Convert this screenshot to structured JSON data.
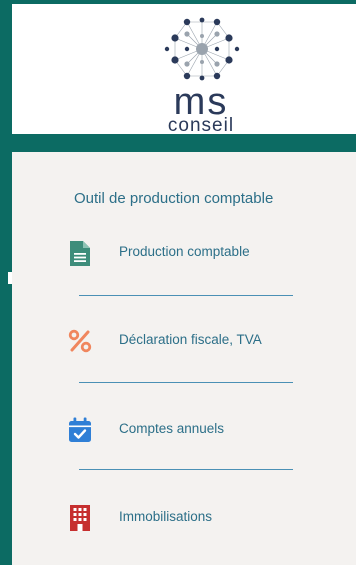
{
  "logo": {
    "brand": "ms",
    "tagline": "conseil",
    "icon": "network-nodes-logo-icon"
  },
  "panel": {
    "title": "Outil de production comptable",
    "items": [
      {
        "label": "Production comptable",
        "icon": "document-icon",
        "color": "#3e8d7b"
      },
      {
        "label": "Déclaration fiscale, TVA",
        "icon": "percent-icon",
        "color": "#f0865e"
      },
      {
        "label": "Comptes annuels",
        "icon": "calendar-check-icon",
        "color": "#2f7fd6"
      },
      {
        "label": "Immobilisations",
        "icon": "building-icon",
        "color": "#c62f2f"
      }
    ]
  },
  "colors": {
    "frame": "#0c6b63",
    "panel_bg": "#f4f2f0",
    "text": "#2c6f88",
    "divider": "#4a90b5",
    "logo_text": "#2b3a5a"
  }
}
